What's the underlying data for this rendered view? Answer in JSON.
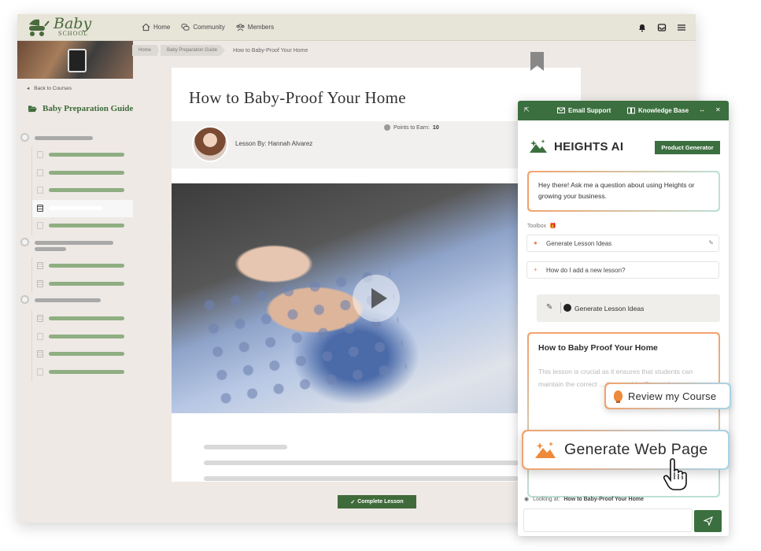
{
  "brand": {
    "name_top": "Baby",
    "name_bottom": "SCHOOL"
  },
  "nav": {
    "items": [
      {
        "label": "Home",
        "icon": "home-icon"
      },
      {
        "label": "Community",
        "icon": "chat-icon"
      },
      {
        "label": "Members",
        "icon": "members-icon"
      }
    ]
  },
  "topbar_icons": [
    "bell-icon",
    "inbox-icon",
    "hamburger-menu-icon"
  ],
  "breadcrumb": {
    "items": [
      "Home",
      "Baby Preparation Guide"
    ],
    "current": "How to Baby-Proof Your Home"
  },
  "sidebar": {
    "back_label": "Back to Courses",
    "course_title": "Baby Preparation Guide"
  },
  "lesson": {
    "title": "How to Baby-Proof Your Home",
    "author_label": "Lesson By: Hannah Alvarez",
    "points_label": "Points to Earn:",
    "points_value": "10",
    "complete_label": "Complete Lesson"
  },
  "ai_panel": {
    "header": {
      "email_support": "Email Support",
      "knowledge_base": "Knowledge Base"
    },
    "brand": "HEIGHTS AI",
    "badge": "Product Generator",
    "greeting": "Hey there! Ask me a question about using Heights or growing your business.",
    "toolbox_label": "Toolbox",
    "tools": [
      {
        "label": "Generate Lesson Ideas"
      },
      {
        "label": "How do I add a new lesson?"
      }
    ],
    "generate_button": "Generate Lesson Ideas",
    "result": {
      "title": "How to Baby Proof Your Home",
      "body": "This lesson is crucial as it ensures that students can maintain the correct ... these guide. Proceed..."
    },
    "looking_label": "Looking at:",
    "looking_value": "How to Baby-Proof Your Home"
  },
  "floating": {
    "review": "Review my Course",
    "web_page": "Generate Web Page"
  },
  "colors": {
    "brand_green": "#3b6f3f",
    "accent_orange": "#ee8a3a",
    "sidebar_bar_green": "#8fae82"
  }
}
